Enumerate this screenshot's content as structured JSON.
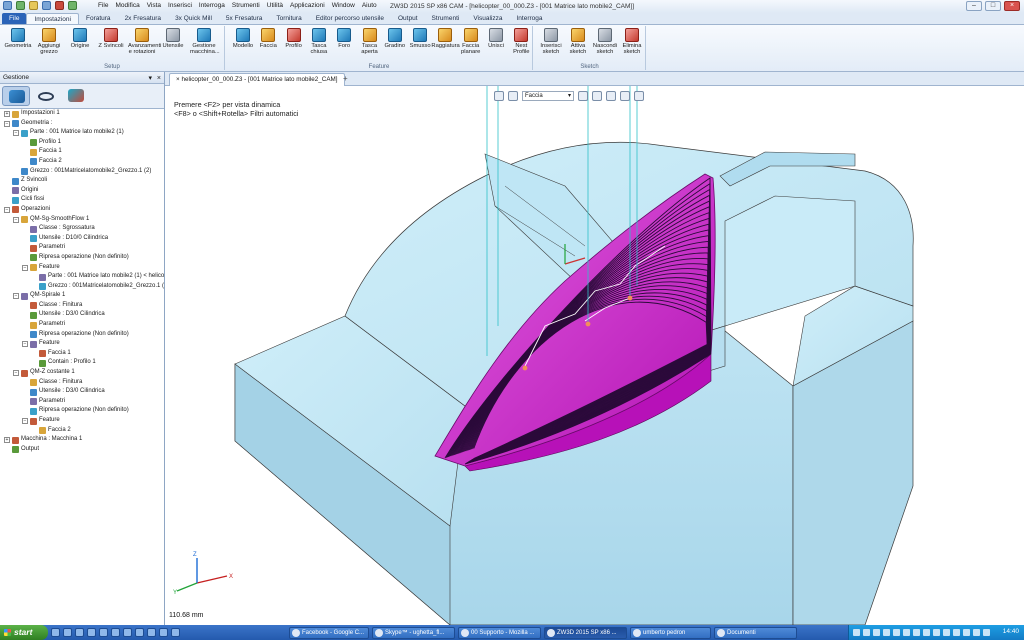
{
  "window": {
    "title": "ZW3D 2015 SP x86    CAM - [helicopter_00_000.Z3 - [001 Matrice lato mobile2_CAM]]",
    "menu": [
      "File",
      "Modifica",
      "Vista",
      "Inserisci",
      "Interroga",
      "Strumenti",
      "Utilità",
      "Applicazioni",
      "Window",
      "Aiuto"
    ]
  },
  "ribbon_tabs": [
    "File",
    "Impostazioni",
    "Foratura",
    "2x Fresatura",
    "3x Quick Mill",
    "5x Fresatura",
    "Tornitura",
    "Editor percorso utensile",
    "Output",
    "Strumenti",
    "Visualizza",
    "Interroga"
  ],
  "active_ribbon_tab": "Impostazioni",
  "ribbon_groups": {
    "setup": {
      "label": "Setup",
      "buttons": [
        "Geometria",
        "Aggiungi grezzo",
        "Origine",
        "Z Svincoli",
        "Avanzamenti e rotazioni",
        "Utensile",
        "Gestione macchina..."
      ]
    },
    "feature": {
      "label": "Feature",
      "buttons": [
        "Modello",
        "Faccia",
        "Profilo",
        "Tasca chiusa",
        "Foro",
        "Tasca aperta",
        "Gradino",
        "Smusso",
        "Raggiatura",
        "Faccia planare",
        "Unisci",
        "Nest Profile"
      ]
    },
    "sketch": {
      "label": "Sketch",
      "buttons": [
        "Inserisci sketch",
        "Attiva sketch",
        "Nascondi sketch",
        "Elimina sketch"
      ]
    }
  },
  "panel": {
    "title": "Gestione"
  },
  "tree": [
    {
      "label": "Impostazioni 1",
      "level": 0
    },
    {
      "label": "Geometria :",
      "level": 0
    },
    {
      "label": "Parte : 001 Matrice lato mobile2 (1)",
      "level": 1
    },
    {
      "label": "Profilo 1",
      "level": 2
    },
    {
      "label": "Faccia 1",
      "level": 2
    },
    {
      "label": "Faccia 2",
      "level": 2
    },
    {
      "label": "Grezzo : 001Matricelatomobile2_Grezzo.1 (2)",
      "level": 1
    },
    {
      "label": "Z Svincoli",
      "level": 0
    },
    {
      "label": "Origini",
      "level": 0
    },
    {
      "label": "Cicli fissi",
      "level": 0
    },
    {
      "label": "Operazioni",
      "level": 0
    },
    {
      "label": "QM-Sg-SmoothFlow 1",
      "level": 1
    },
    {
      "label": "Classe : Sgrossatura",
      "level": 2
    },
    {
      "label": "Utensile : D10/0 Cilindrica",
      "level": 2
    },
    {
      "label": "Parametri",
      "level": 2
    },
    {
      "label": "Ripresa operazione (Non definito)",
      "level": 2
    },
    {
      "label": "Feature",
      "level": 2
    },
    {
      "label": "Parte : 001 Matrice lato mobile2 (1) < helicopt",
      "level": 3
    },
    {
      "label": "Grezzo : 001Matricelatomobile2_Grezzo.1 (2)",
      "level": 3
    },
    {
      "label": "QM-Spirale 1",
      "level": 1
    },
    {
      "label": "Classe : Finitura",
      "level": 2
    },
    {
      "label": "Utensile : D3/0 Cilindrica",
      "level": 2
    },
    {
      "label": "Parametri",
      "level": 2
    },
    {
      "label": "Ripresa operazione (Non definito)",
      "level": 2
    },
    {
      "label": "Feature",
      "level": 2
    },
    {
      "label": "Faccia 1",
      "level": 3
    },
    {
      "label": "Contain : Profilo 1",
      "level": 3
    },
    {
      "label": "QM-Z costante 1",
      "level": 1
    },
    {
      "label": "Classe : Finitura",
      "level": 2
    },
    {
      "label": "Utensile : D3/0 Cilindrica",
      "level": 2
    },
    {
      "label": "Parametri",
      "level": 2
    },
    {
      "label": "Ripresa operazione (Non definito)",
      "level": 2
    },
    {
      "label": "Feature",
      "level": 2
    },
    {
      "label": "Faccia 2",
      "level": 3
    },
    {
      "label": "Macchina : Macchina 1",
      "level": 0
    },
    {
      "label": "Output",
      "level": 0
    }
  ],
  "document_tab": "helicopter_00_000.Z3 - [001 Matrice lato mobile2_CAM]",
  "viewport": {
    "hint_line1": "Premere <F2> per vista dinamica",
    "hint_line2": "<F8> o <Shift+Rotella> Filtri automatici",
    "filter_value": "Faccia",
    "scale": "110.68 mm"
  },
  "taskbar": {
    "start": "start",
    "windows": [
      "Facebook - Google C...",
      "Skype™ - ughetta_fl...",
      "00 Supporto - Mozilla ...",
      "ZW3D 2015 SP x86 ...",
      "umberto pedron",
      "Documenti"
    ],
    "active_window": "ZW3D 2015 SP x86 ...",
    "clock": "14:40"
  },
  "colors": {
    "part": "#c2e6f4",
    "toolpath": "#cc33cc",
    "accent": "#2a63b8"
  }
}
